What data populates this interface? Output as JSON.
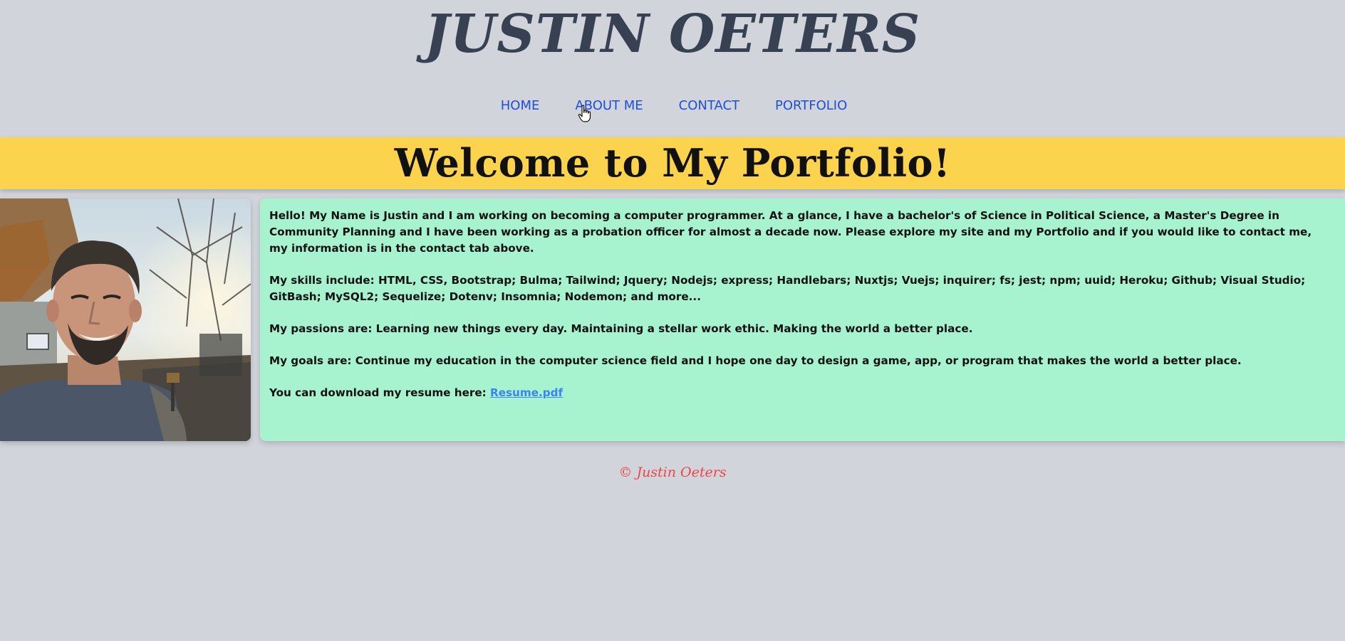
{
  "header": {
    "site_title": "JUSTIN OETERS"
  },
  "nav": {
    "items": [
      {
        "label": "HOME"
      },
      {
        "label": "ABOUT ME"
      },
      {
        "label": "CONTACT"
      },
      {
        "label": "PORTFOLIO"
      }
    ]
  },
  "banner": {
    "heading": "Welcome to My Portfolio!"
  },
  "profile": {
    "photo_icon": "portrait-photo"
  },
  "about": {
    "intro": "Hello! My Name is Justin and I am working on becoming a computer programmer. At a glance, I have a bachelor's of Science in Political Science, a Master's Degree in Community Planning and I have been working as a probation officer for almost a decade now. Please explore my site and my Portfolio and if you would like to contact me, my information is in the contact tab above.",
    "skills": "My skills include: HTML, CSS, Bootstrap; Bulma; Tailwind; Jquery; Nodejs; express; Handlebars; Nuxtjs; Vuejs; inquirer; fs; jest; npm; uuid; Heroku; Github; Visual Studio; GitBash; MySQL2; Sequelize; Dotenv; Insomnia; Nodemon; and more...",
    "passions": "My passions are: Learning new things every day. Maintaining a stellar work ethic. Making the world a better place.",
    "goals": "My goals are: Continue my education in the computer science field and I hope one day to design a game, app, or program that makes the world a better place.",
    "resume_prefix": "You can download my resume here: ",
    "resume_link": "Resume.pdf"
  },
  "footer": {
    "copyright": "© Justin Oeters"
  },
  "colors": {
    "background": "#d1d5db",
    "title": "#374151",
    "nav_link": "#1d4ed8",
    "banner": "#fcd34d",
    "about_card": "#a7f3d0",
    "resume_link": "#3b82f6",
    "footer": "#ef4444"
  }
}
